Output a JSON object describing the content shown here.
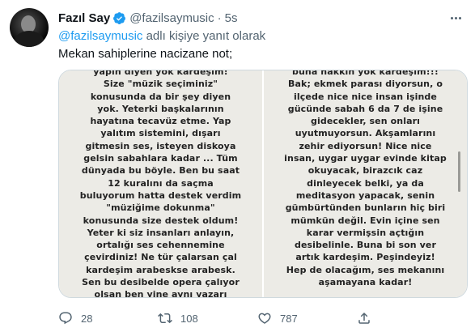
{
  "tweet": {
    "display_name": "Fazıl Say",
    "handle": "@fazilsaymusic",
    "separator": "·",
    "time": "5s",
    "reply_mention": "@fazilsaymusic",
    "reply_suffix": " adlı kişiye yanıt olarak",
    "text": "Mekan sahiplerine nacizane not;",
    "colors": {
      "link": "#1d9bf0",
      "muted": "#536471",
      "verified": "#1d9bf0"
    }
  },
  "media": {
    "left_lines": [
      "yapin diyen yok kardeşim!",
      "Size \"müzik seçiminiz\"",
      "konusunda da bir şey diyen",
      "yok. Yeterki başkalarının",
      "hayatına tecavüz etme. Yap",
      "yalıtım sistemini, dışarı",
      "gitmesin ses, isteyen diskoya",
      "gelsin sabahlara kadar ... Tüm",
      "dünyada bu böyle. Ben bu saat",
      "12 kuralını da saçma",
      "buluyorum hatta destek verdim",
      "\"müziğime dokunma\"",
      "konusunda size destek oldum!",
      "Yeter ki siz insanları anlayın,",
      "ortalığı ses cehennemine",
      "çevirdiniz! Ne tür çalarsan çal",
      "kardeşim arabeskse arabesk.",
      "Sen bu desibelde opera çalıyor",
      "olsan ben yine aynı yazarı"
    ],
    "right_lines": [
      "buna hakkın yok kardeşim!!!",
      "Bak; ekmek parası diyorsun, o",
      "ilçede nice nice insan işinde",
      "gücünde sabah 6 da 7 de işine",
      "gidecekler, sen onları",
      "uyutmuyorsun. Akşamlarını",
      "zehir ediyorsun! Nice nice",
      "insan, uygar uygar evinde kitap",
      "okuyacak, birazcık caz",
      "dinleyecek belki, ya da",
      "meditasyon yapacak, senin",
      "gümbürtünden bunların hiç biri",
      "mümkün değil. Evin içine sen",
      "karar vermişsin açtığın",
      "desibelinle. Buna bi son ver",
      "artık kardeşim. Peşindeyiz!",
      "Hep de olacağım, ses mekanını",
      "aşamayana kadar!"
    ]
  },
  "actions": {
    "reply_count": "28",
    "retweet_count": "108",
    "like_count": "787",
    "reply_icon": "reply-icon",
    "retweet_icon": "retweet-icon",
    "like_icon": "heart-icon",
    "share_icon": "share-icon"
  }
}
